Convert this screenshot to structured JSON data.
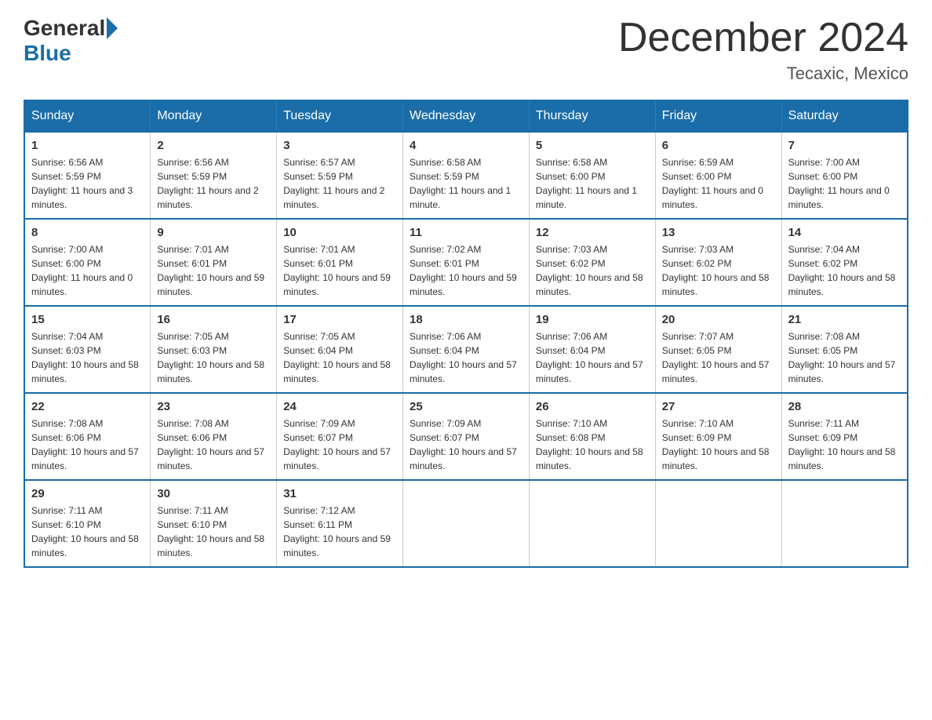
{
  "header": {
    "logo_general": "General",
    "logo_blue": "Blue",
    "month_title": "December 2024",
    "location": "Tecaxic, Mexico"
  },
  "days_of_week": [
    "Sunday",
    "Monday",
    "Tuesday",
    "Wednesday",
    "Thursday",
    "Friday",
    "Saturday"
  ],
  "weeks": [
    [
      {
        "day": "1",
        "sunrise": "6:56 AM",
        "sunset": "5:59 PM",
        "daylight": "11 hours and 3 minutes."
      },
      {
        "day": "2",
        "sunrise": "6:56 AM",
        "sunset": "5:59 PM",
        "daylight": "11 hours and 2 minutes."
      },
      {
        "day": "3",
        "sunrise": "6:57 AM",
        "sunset": "5:59 PM",
        "daylight": "11 hours and 2 minutes."
      },
      {
        "day": "4",
        "sunrise": "6:58 AM",
        "sunset": "5:59 PM",
        "daylight": "11 hours and 1 minute."
      },
      {
        "day": "5",
        "sunrise": "6:58 AM",
        "sunset": "6:00 PM",
        "daylight": "11 hours and 1 minute."
      },
      {
        "day": "6",
        "sunrise": "6:59 AM",
        "sunset": "6:00 PM",
        "daylight": "11 hours and 0 minutes."
      },
      {
        "day": "7",
        "sunrise": "7:00 AM",
        "sunset": "6:00 PM",
        "daylight": "11 hours and 0 minutes."
      }
    ],
    [
      {
        "day": "8",
        "sunrise": "7:00 AM",
        "sunset": "6:00 PM",
        "daylight": "11 hours and 0 minutes."
      },
      {
        "day": "9",
        "sunrise": "7:01 AM",
        "sunset": "6:01 PM",
        "daylight": "10 hours and 59 minutes."
      },
      {
        "day": "10",
        "sunrise": "7:01 AM",
        "sunset": "6:01 PM",
        "daylight": "10 hours and 59 minutes."
      },
      {
        "day": "11",
        "sunrise": "7:02 AM",
        "sunset": "6:01 PM",
        "daylight": "10 hours and 59 minutes."
      },
      {
        "day": "12",
        "sunrise": "7:03 AM",
        "sunset": "6:02 PM",
        "daylight": "10 hours and 58 minutes."
      },
      {
        "day": "13",
        "sunrise": "7:03 AM",
        "sunset": "6:02 PM",
        "daylight": "10 hours and 58 minutes."
      },
      {
        "day": "14",
        "sunrise": "7:04 AM",
        "sunset": "6:02 PM",
        "daylight": "10 hours and 58 minutes."
      }
    ],
    [
      {
        "day": "15",
        "sunrise": "7:04 AM",
        "sunset": "6:03 PM",
        "daylight": "10 hours and 58 minutes."
      },
      {
        "day": "16",
        "sunrise": "7:05 AM",
        "sunset": "6:03 PM",
        "daylight": "10 hours and 58 minutes."
      },
      {
        "day": "17",
        "sunrise": "7:05 AM",
        "sunset": "6:04 PM",
        "daylight": "10 hours and 58 minutes."
      },
      {
        "day": "18",
        "sunrise": "7:06 AM",
        "sunset": "6:04 PM",
        "daylight": "10 hours and 57 minutes."
      },
      {
        "day": "19",
        "sunrise": "7:06 AM",
        "sunset": "6:04 PM",
        "daylight": "10 hours and 57 minutes."
      },
      {
        "day": "20",
        "sunrise": "7:07 AM",
        "sunset": "6:05 PM",
        "daylight": "10 hours and 57 minutes."
      },
      {
        "day": "21",
        "sunrise": "7:08 AM",
        "sunset": "6:05 PM",
        "daylight": "10 hours and 57 minutes."
      }
    ],
    [
      {
        "day": "22",
        "sunrise": "7:08 AM",
        "sunset": "6:06 PM",
        "daylight": "10 hours and 57 minutes."
      },
      {
        "day": "23",
        "sunrise": "7:08 AM",
        "sunset": "6:06 PM",
        "daylight": "10 hours and 57 minutes."
      },
      {
        "day": "24",
        "sunrise": "7:09 AM",
        "sunset": "6:07 PM",
        "daylight": "10 hours and 57 minutes."
      },
      {
        "day": "25",
        "sunrise": "7:09 AM",
        "sunset": "6:07 PM",
        "daylight": "10 hours and 57 minutes."
      },
      {
        "day": "26",
        "sunrise": "7:10 AM",
        "sunset": "6:08 PM",
        "daylight": "10 hours and 58 minutes."
      },
      {
        "day": "27",
        "sunrise": "7:10 AM",
        "sunset": "6:09 PM",
        "daylight": "10 hours and 58 minutes."
      },
      {
        "day": "28",
        "sunrise": "7:11 AM",
        "sunset": "6:09 PM",
        "daylight": "10 hours and 58 minutes."
      }
    ],
    [
      {
        "day": "29",
        "sunrise": "7:11 AM",
        "sunset": "6:10 PM",
        "daylight": "10 hours and 58 minutes."
      },
      {
        "day": "30",
        "sunrise": "7:11 AM",
        "sunset": "6:10 PM",
        "daylight": "10 hours and 58 minutes."
      },
      {
        "day": "31",
        "sunrise": "7:12 AM",
        "sunset": "6:11 PM",
        "daylight": "10 hours and 59 minutes."
      },
      null,
      null,
      null,
      null
    ]
  ]
}
